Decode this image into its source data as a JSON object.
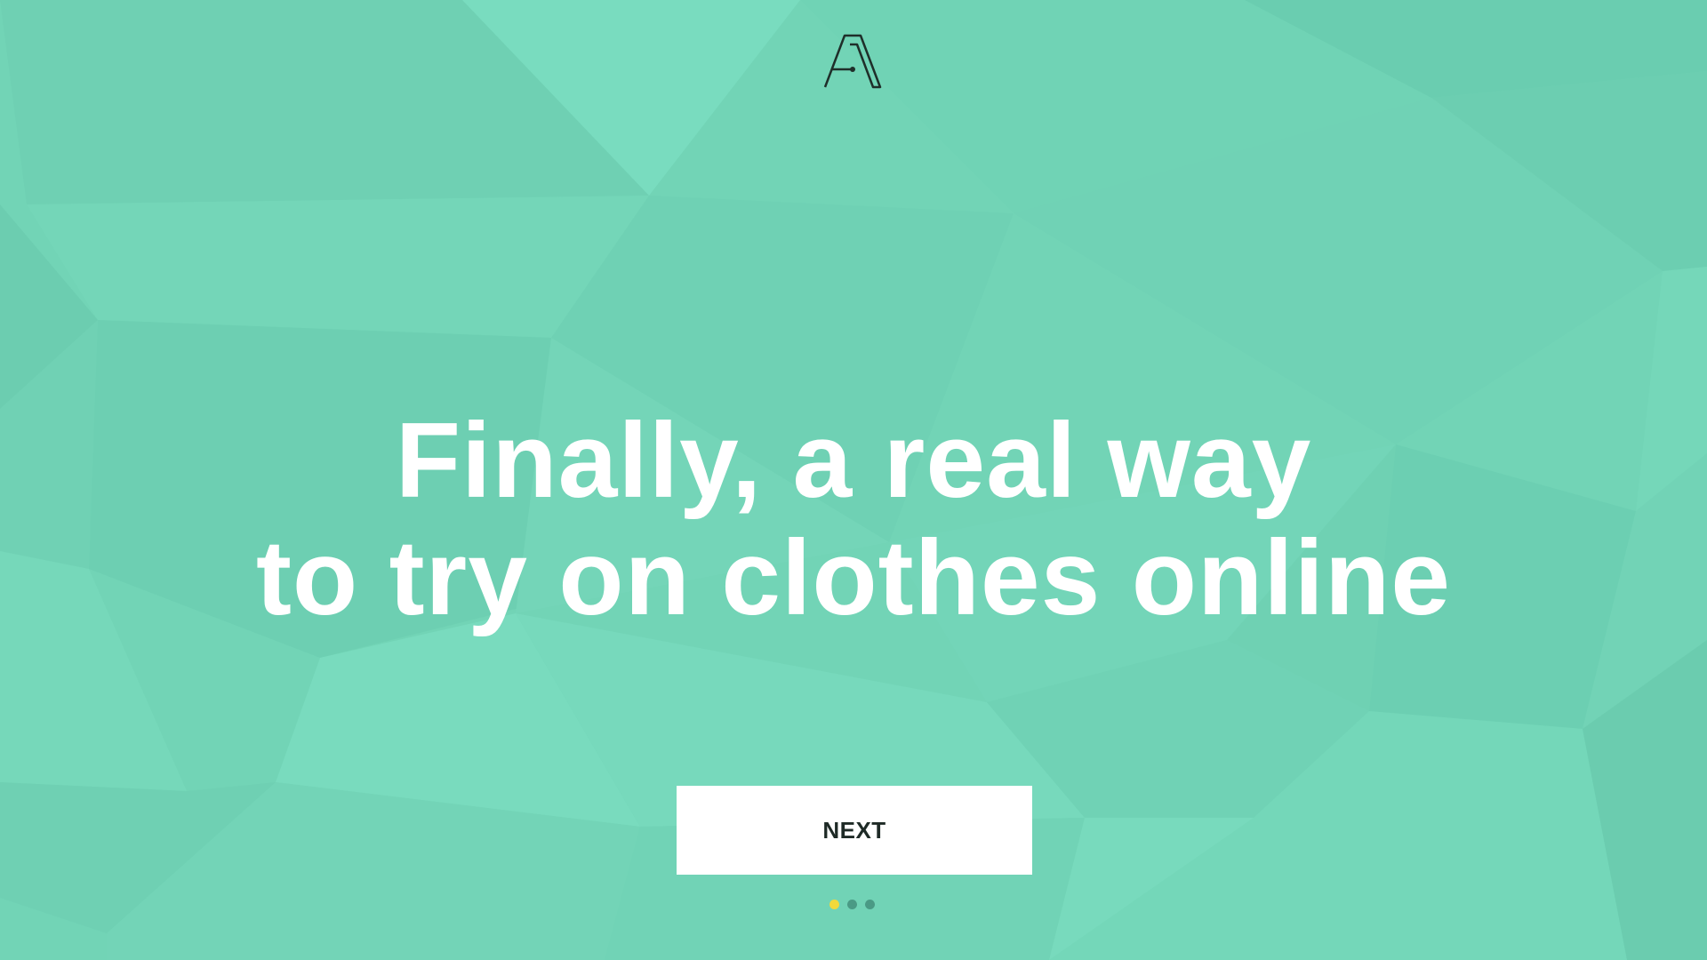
{
  "brand": {
    "logo_icon": "letter-a-logo-icon"
  },
  "headline": {
    "line1": "Finally, a real way",
    "line2": "to try on clothes online"
  },
  "next_button": {
    "label": "NEXT"
  },
  "pagination": {
    "total": 3,
    "active_index": 0
  },
  "colors": {
    "background": "#72d4b6",
    "headline": "#ffffff",
    "button_bg": "#ffffff",
    "button_text": "#1e2a26",
    "dot_active": "#f2d93a",
    "dot_inactive": "#4a9a85"
  }
}
